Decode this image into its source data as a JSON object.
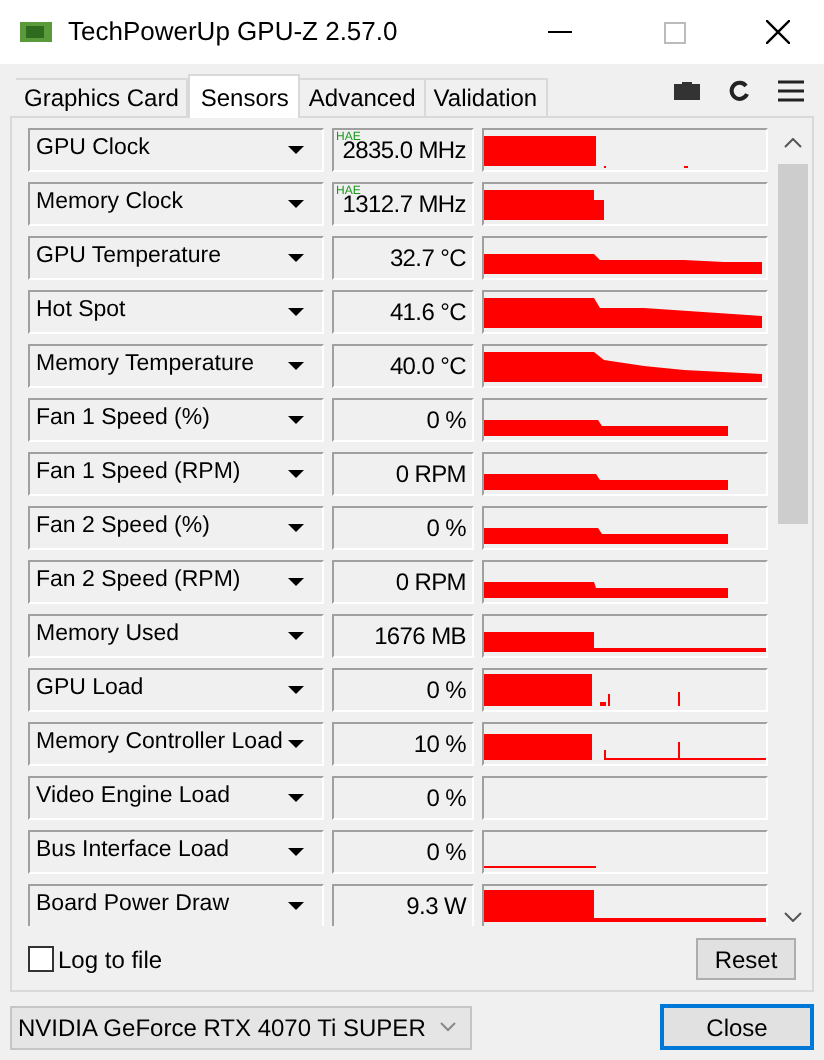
{
  "window": {
    "title": "TechPowerUp GPU-Z 2.57.0"
  },
  "tabs": [
    {
      "label": "Graphics Card",
      "selected": false
    },
    {
      "label": "Sensors",
      "selected": true
    },
    {
      "label": "Advanced",
      "selected": false
    },
    {
      "label": "Validation",
      "selected": false
    }
  ],
  "sensors": [
    {
      "name": "GPU Clock",
      "value": "2835.0 MHz",
      "badge": "HAE"
    },
    {
      "name": "Memory Clock",
      "value": "1312.7 MHz",
      "badge": "HAE"
    },
    {
      "name": "GPU Temperature",
      "value": "32.7 °C"
    },
    {
      "name": "Hot Spot",
      "value": "41.6 °C"
    },
    {
      "name": "Memory Temperature",
      "value": "40.0 °C"
    },
    {
      "name": "Fan 1 Speed (%)",
      "value": "0 %"
    },
    {
      "name": "Fan 1 Speed (RPM)",
      "value": "0 RPM"
    },
    {
      "name": "Fan 2 Speed (%)",
      "value": "0 %"
    },
    {
      "name": "Fan 2 Speed (RPM)",
      "value": "0 RPM"
    },
    {
      "name": "Memory Used",
      "value": "1676 MB"
    },
    {
      "name": "GPU Load",
      "value": "0 %"
    },
    {
      "name": "Memory Controller Load",
      "value": "10 %"
    },
    {
      "name": "Video Engine Load",
      "value": "0 %"
    },
    {
      "name": "Bus Interface Load",
      "value": "0 %"
    },
    {
      "name": "Board Power Draw",
      "value": "9.3 W"
    }
  ],
  "log_to_file": {
    "label": "Log to file",
    "checked": false
  },
  "reset_button": "Reset",
  "gpu_select": {
    "value": "NVIDIA GeForce RTX 4070 Ti SUPER"
  },
  "close_button": "Close"
}
